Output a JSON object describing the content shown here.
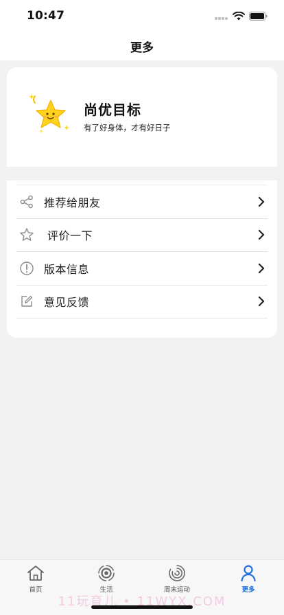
{
  "status_bar": {
    "time": "10:47"
  },
  "nav": {
    "title": "更多"
  },
  "profile": {
    "title": "尚优目标",
    "subtitle": "有了好身体，才有好日子"
  },
  "menu": {
    "items": [
      {
        "label": "推荐给朋友",
        "icon": "share-icon"
      },
      {
        "label": "评价一下",
        "icon": "star-outline-icon"
      },
      {
        "label": "版本信息",
        "icon": "info-circle-icon"
      },
      {
        "label": "意见反馈",
        "icon": "edit-icon"
      }
    ]
  },
  "tabs": [
    {
      "label": "首页",
      "icon": "home-icon",
      "active": false
    },
    {
      "label": "生活",
      "icon": "life-icon",
      "active": false
    },
    {
      "label": "周末运动",
      "icon": "spiral-icon",
      "active": false
    },
    {
      "label": "更多",
      "icon": "person-icon",
      "active": true
    }
  ],
  "watermark": "11玩育儿 • 11WYX.COM",
  "colors": {
    "accent": "#1f6fe0",
    "background": "#f2f2f2",
    "card": "#ffffff",
    "star": "#ffd21e"
  }
}
